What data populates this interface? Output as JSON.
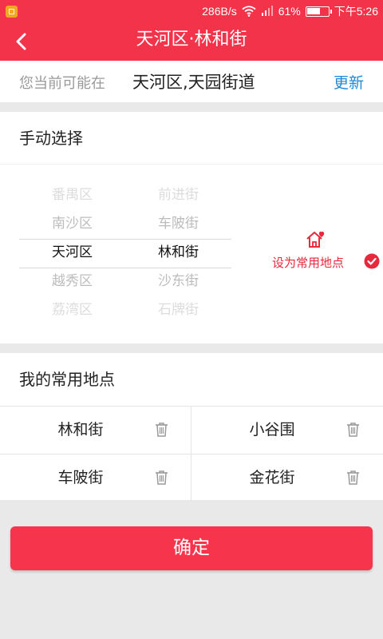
{
  "status_bar": {
    "speed": "286B/s",
    "battery_percent_text": "61%",
    "battery_level": 0.61,
    "time": "下午5:26"
  },
  "title_bar": {
    "title": "天河区·林和街",
    "back_icon": "chevron-left-icon"
  },
  "location": {
    "label": "您当前可能在",
    "value": "天河区,天园街道",
    "refresh_label": "更新"
  },
  "manual_select": {
    "heading": "手动选择",
    "district_options": [
      "番禺区",
      "南沙区",
      "天河区",
      "越秀区",
      "荔湾区"
    ],
    "street_options": [
      "前进街",
      "车陂街",
      "林和街",
      "沙东街",
      "石牌街"
    ],
    "selected_index": 2,
    "set_favorite_label": "设为常用地点"
  },
  "favorites": {
    "heading": "我的常用地点",
    "items": [
      "林和街",
      "小谷围",
      "车陂街",
      "金花街"
    ]
  },
  "confirm_label": "确定",
  "colors": {
    "brand_red": "#f2334a",
    "link_blue": "#1e88d9",
    "accent_red": "#e8283c"
  }
}
